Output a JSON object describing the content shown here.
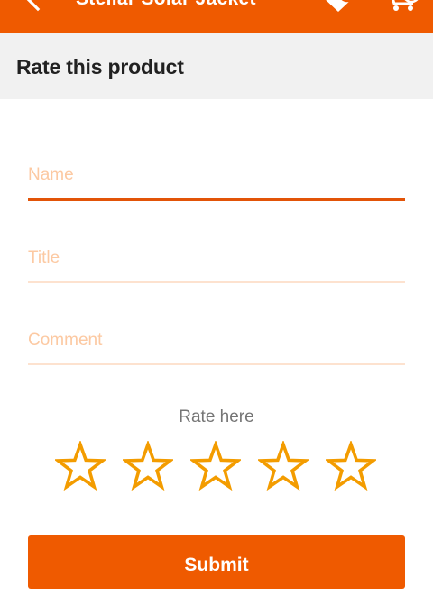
{
  "app_bar": {
    "title": "Stellar Solar Jacket",
    "back_icon": "back-arrow-icon",
    "wishlist_icon": "heart-icon",
    "cart_icon": "cart-icon",
    "background": "#ef5a00"
  },
  "section": {
    "heading": "Rate this product"
  },
  "form": {
    "name": {
      "value": "",
      "placeholder": "Name"
    },
    "title": {
      "value": "",
      "placeholder": "Title"
    },
    "comment": {
      "value": "",
      "placeholder": "Comment"
    }
  },
  "rating": {
    "label": "Rate here",
    "max": 5,
    "value": 0,
    "star_icon": "star-outline-icon",
    "star_color": "#f39c00"
  },
  "submit_label": "Submit",
  "colors": {
    "accent": "#ef5a00",
    "underline_active": "#e25408",
    "placeholder": "#fcc9a2",
    "header_bg": "#f1f1f1"
  }
}
